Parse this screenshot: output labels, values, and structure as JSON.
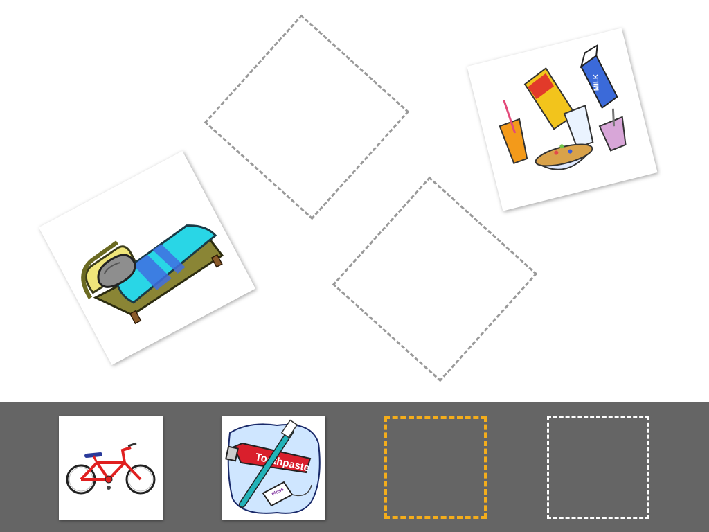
{
  "stage": {
    "drop_zones": [
      {
        "name": "upper"
      },
      {
        "name": "lower"
      }
    ],
    "placed_cards": [
      {
        "icon": "bed-icon"
      },
      {
        "icon": "breakfast-icon"
      }
    ]
  },
  "tray": {
    "cards": [
      {
        "icon": "bicycle-icon"
      },
      {
        "icon": "toothpaste-icon",
        "tube_label": "Toothpaste",
        "box_label": "Floss"
      }
    ],
    "slots": [
      {
        "state": "active"
      },
      {
        "state": "empty"
      }
    ]
  },
  "colors": {
    "tray_background": "#656565",
    "active_slot_border": "#f4ad1c",
    "drop_zone_border": "#9a9a9a"
  },
  "breakfast": {
    "milk_label": "MILK"
  }
}
